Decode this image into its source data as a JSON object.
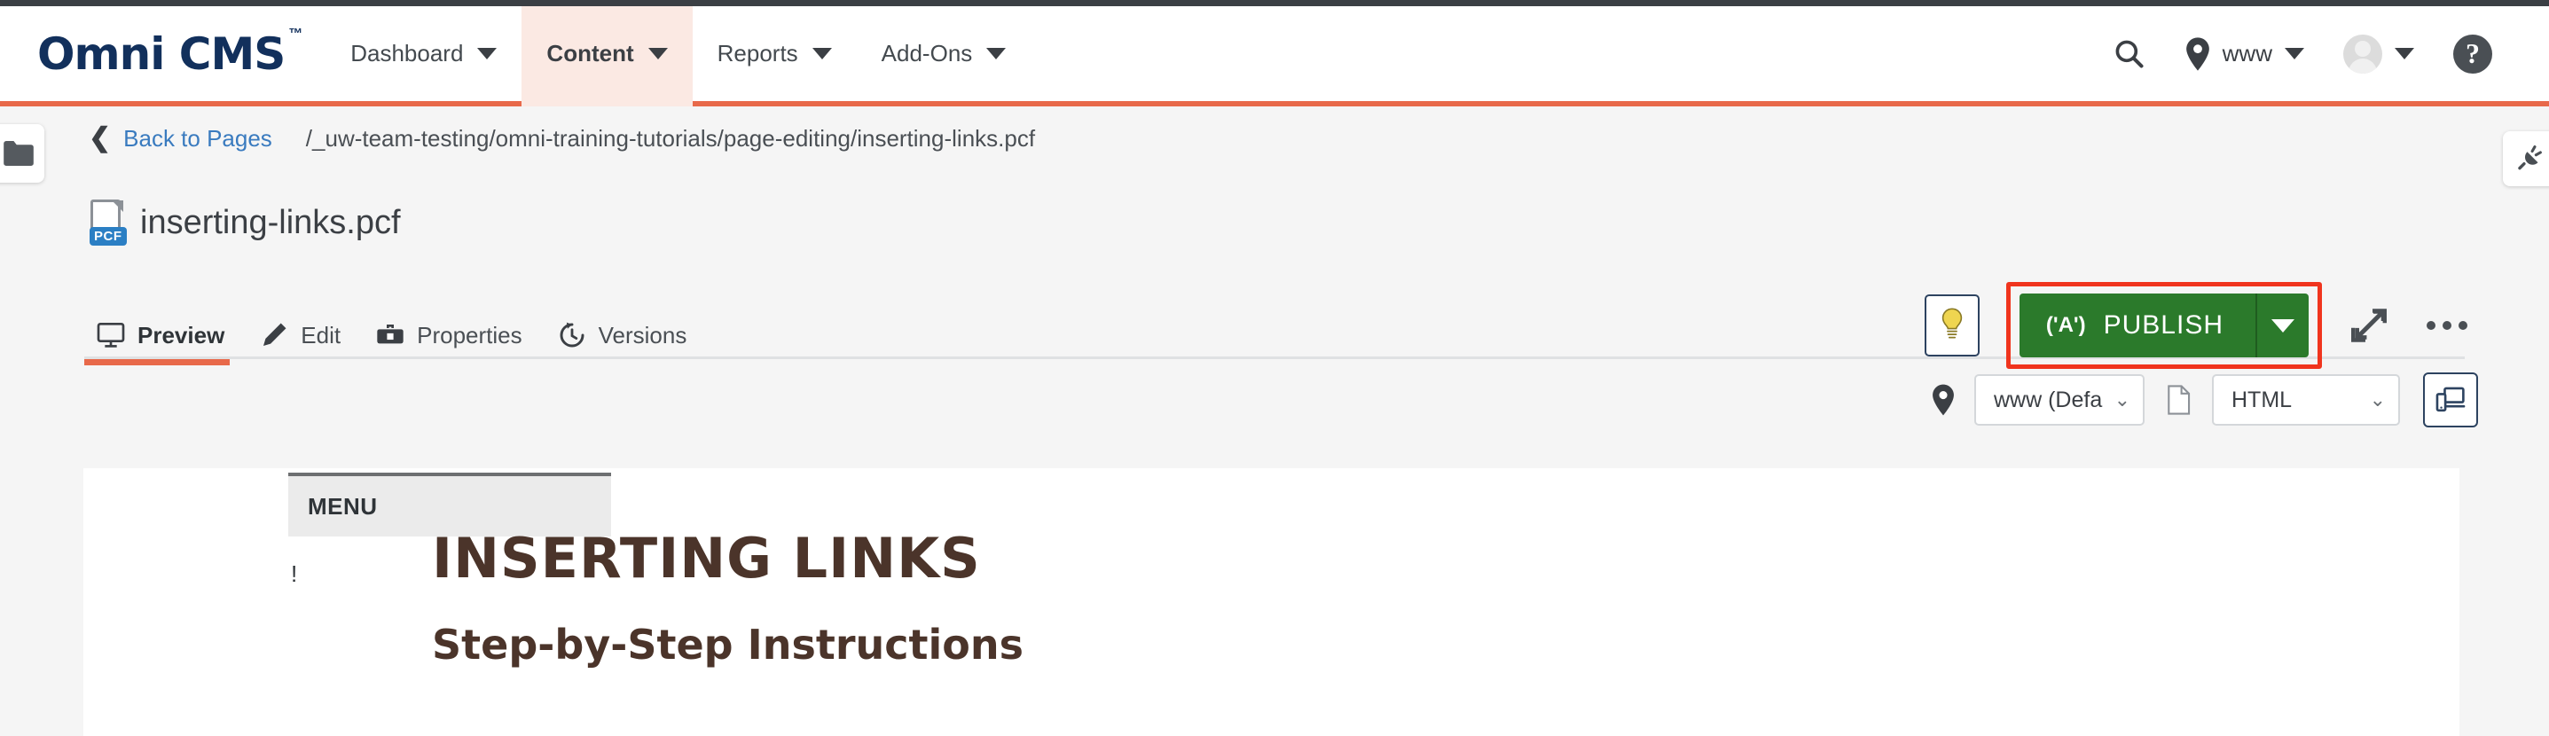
{
  "brand": {
    "name": "Omni CMS",
    "tm": "™"
  },
  "nav": {
    "items": [
      {
        "label": "Dashboard",
        "icon": "chevron-down-icon",
        "active": false
      },
      {
        "label": "Content",
        "icon": "chevron-down-icon",
        "active": true
      },
      {
        "label": "Reports",
        "icon": "chevron-down-icon",
        "active": false
      },
      {
        "label": "Add-Ons",
        "icon": "chevron-down-icon",
        "active": false
      }
    ],
    "right": {
      "search_icon": "search-icon",
      "location_icon": "location-pin-icon",
      "site": "www",
      "site_caret": "chevron-down-icon",
      "avatar": "user-avatar-icon",
      "avatar_caret": "chevron-down-icon",
      "help": "?"
    }
  },
  "edge_tabs": {
    "left_icon": "folder-icon",
    "right_icon": "plug-icon"
  },
  "breadcrumb": {
    "back_chevron": "chevron-left-icon",
    "back_label": "Back to Pages",
    "path": "/_uw-team-testing/omni-training-tutorials/page-editing/inserting-links.pcf"
  },
  "page": {
    "file_icon_badge": "PCF",
    "title": "inserting-links.pcf"
  },
  "tabs": [
    {
      "label": "Preview",
      "icon": "monitor-icon",
      "active": true
    },
    {
      "label": "Edit",
      "icon": "pencil-icon",
      "active": false
    },
    {
      "label": "Properties",
      "icon": "toolbox-icon",
      "active": false
    },
    {
      "label": "Versions",
      "icon": "history-clock-icon",
      "active": false
    }
  ],
  "actions": {
    "bulb_icon": "lightbulb-icon",
    "publish_icon": "broadcast-icon",
    "publish_label": "PUBLISH",
    "publish_caret": "caret-down-icon",
    "expand_icon": "expand-arrows-icon",
    "more_icon": "more-options-icon",
    "highlight_color": "#f0341d",
    "publish_color": "#2b7a2b"
  },
  "subtoolbar": {
    "pin_icon": "location-pin-icon",
    "site_value": "www (Defa",
    "site_options": [
      "www (Default)"
    ],
    "doc_icon": "document-icon",
    "format_value": "HTML",
    "format_options": [
      "HTML"
    ],
    "device_icon": "responsive-devices-icon"
  },
  "preview": {
    "menu_label": "MENU",
    "bang": "!",
    "heading1": "INSERTING LINKS",
    "heading2": "Step-by-Step Instructions",
    "heading_color": "#4b342a"
  }
}
